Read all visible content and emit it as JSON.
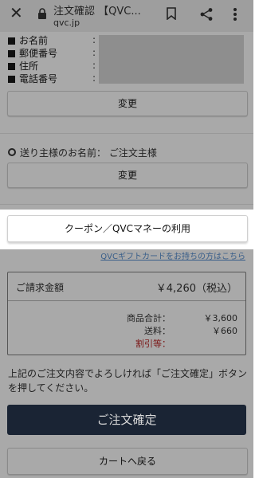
{
  "browser": {
    "title": "注文確認 【QVC...",
    "domain": "qvc.jp"
  },
  "customer_info": {
    "labels": [
      "お名前",
      "郵便番号",
      "住所",
      "電話番号"
    ],
    "colon": ":",
    "change_label": "変更"
  },
  "sender": {
    "text": "送り主様のお名前：  ご注文主様",
    "change_label": "変更"
  },
  "coupon": {
    "label": "クーポン／QVCマネーの利用"
  },
  "gift_link": "QVCギフトカードをお持ちの方はこちら",
  "bill": {
    "title": "ご請求金額",
    "total": "￥4,260（税込）",
    "subtotal_label": "商品合計：",
    "subtotal_value": "￥3,600",
    "shipping_label": "送料：",
    "shipping_value": "￥660",
    "discount_label": "割引等："
  },
  "confirm_text": "上記のご注文内容でよろしければ「ご注文確定」ボタンを押してください。",
  "buttons": {
    "confirm": "ご注文確定",
    "back_to_cart": "カートへ戻る"
  },
  "colors": {
    "overlay": "#a9a9a9",
    "confirm_bg": "#1a2434",
    "discount": "#7a1515",
    "link": "#3a5f8a"
  }
}
